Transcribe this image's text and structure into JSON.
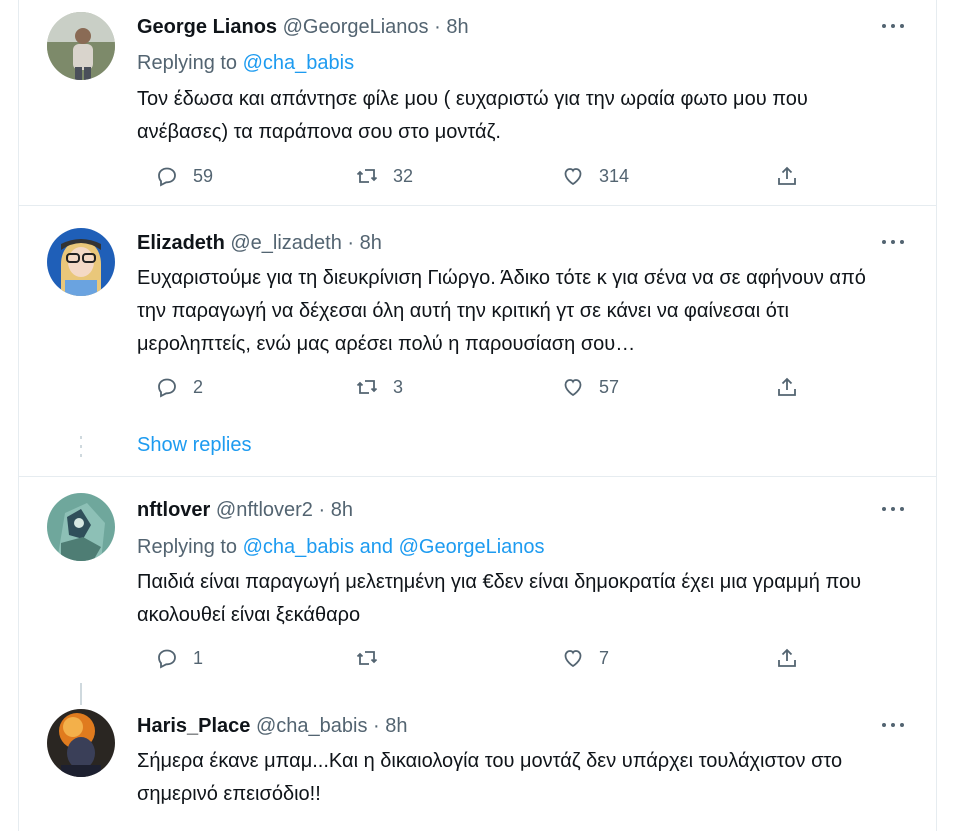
{
  "tweets": [
    {
      "name": "George Lianos",
      "handle": "@GeorgeLianos",
      "time": "· 8h",
      "replying_prefix": "Replying to ",
      "replying_to": [
        "@cha_babis"
      ],
      "text": "Τον έδωσα και απάντησε φίλε μου ( ευχαριστώ για την ωραία φωτο μου που ανέβασες) τα παράπονα σου στο μοντάζ.",
      "replies": "59",
      "retweets": "32",
      "likes": "314"
    },
    {
      "name": "Elizadeth",
      "handle": "@e_lizadeth",
      "time": "· 8h",
      "text": "Ευχαριστούμε για τη διευκρίνιση Γιώργο. Άδικο τότε κ για σένα να σε αφήνουν από την παραγωγή να δέχεσαι όλη αυτή την κριτική γτ σε κάνει να φαίνεσαι ότι μεροληπτείς, ενώ μας αρέσει πολύ η παρουσίαση σου…",
      "replies": "2",
      "retweets": "3",
      "likes": "57"
    },
    {
      "name": "nftlover",
      "handle": "@nftlover2",
      "time": "· 8h",
      "replying_prefix": "Replying to ",
      "replying_to": [
        "@cha_babis",
        "@GeorgeLianos"
      ],
      "replying_joiner": " and ",
      "text": "Παιδιά είναι παραγωγή μελετημένη για €δεν είναι δημοκρατία έχει μια γραμμή που ακολουθεί είναι ξεκάθαρο",
      "replies": "1",
      "retweets": "",
      "likes": "7"
    },
    {
      "name": "Haris_Place",
      "handle": "@cha_babis",
      "time": "· 8h",
      "text": "Σήμερα έκανε μπαμ...Και η δικαιολογία του μοντάζ δεν υπάρχει τουλάχιστον στο σημερινό επεισόδιο!!"
    }
  ],
  "show_replies": "Show replies",
  "icons": {
    "reply": "reply-icon",
    "retweet": "retweet-icon",
    "like": "like-icon",
    "share": "share-icon",
    "more": "more-icon"
  },
  "colors": {
    "link": "#1d9bf0",
    "secondary": "#536471",
    "text": "#0f1419",
    "border": "#e6ecf0"
  }
}
